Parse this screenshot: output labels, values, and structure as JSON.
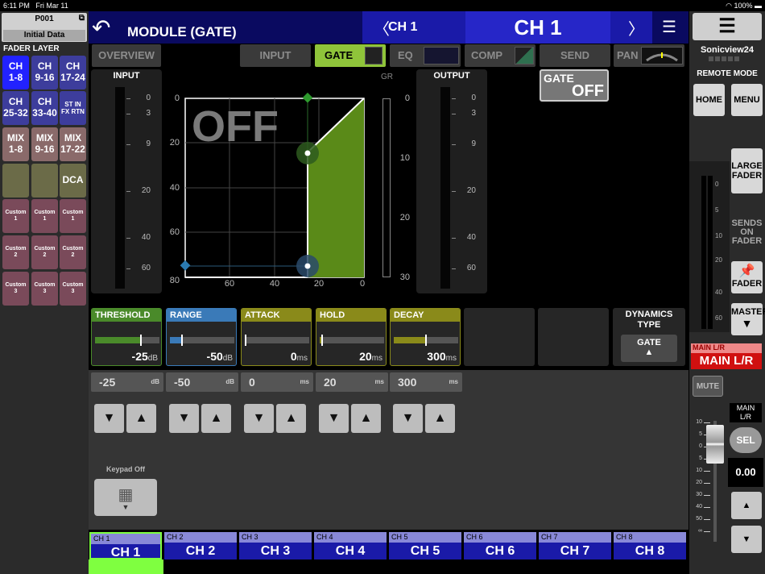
{
  "status": {
    "time": "6:11 PM",
    "date": "Fri Mar 11",
    "battery": "100%"
  },
  "scene": {
    "number": "P001",
    "title": "Initial Data"
  },
  "fader_layer": {
    "heading": "FADER LAYER",
    "buttons": [
      {
        "l1": "CH",
        "l2": "1-8"
      },
      {
        "l1": "CH",
        "l2": "9-16"
      },
      {
        "l1": "CH",
        "l2": "17-24"
      },
      {
        "l1": "CH",
        "l2": "25-32"
      },
      {
        "l1": "CH",
        "l2": "33-40"
      },
      {
        "l1": "ST IN",
        "l2": "FX RTN"
      },
      {
        "l1": "MIX",
        "l2": "1-8"
      },
      {
        "l1": "MIX",
        "l2": "9-16"
      },
      {
        "l1": "MIX",
        "l2": "17-22"
      },
      {
        "l1": "",
        "l2": ""
      },
      {
        "l1": "",
        "l2": ""
      },
      {
        "l1": "DCA",
        "l2": ""
      },
      {
        "l1": "Custom",
        "l2": "1"
      },
      {
        "l1": "Custom",
        "l2": "1"
      },
      {
        "l1": "Custom",
        "l2": "1"
      },
      {
        "l1": "Custom",
        "l2": "2"
      },
      {
        "l1": "Custom",
        "l2": "2"
      },
      {
        "l1": "Custom",
        "l2": "2"
      },
      {
        "l1": "Custom",
        "l2": "3"
      },
      {
        "l1": "Custom",
        "l2": "3"
      },
      {
        "l1": "Custom",
        "l2": "3"
      }
    ]
  },
  "header": {
    "title": "MODULE (GATE)",
    "ch_small": "CH 1",
    "ch_big": "CH 1"
  },
  "tabs": {
    "overview": "OVERVIEW",
    "input": "INPUT",
    "gate": "GATE",
    "eq": "EQ",
    "comp": "COMP",
    "send": "SEND",
    "pan": "PAN"
  },
  "input_meter": {
    "label": "INPUT",
    "scale": [
      "0",
      "3",
      "9",
      "20",
      "40",
      "60"
    ]
  },
  "output_meter": {
    "label": "OUTPUT",
    "scale": [
      "0",
      "3",
      "9",
      "20",
      "40",
      "60"
    ]
  },
  "graph": {
    "off_text": "OFF",
    "y_ticks": [
      "0",
      "20",
      "40",
      "60",
      "80"
    ],
    "x_ticks": [
      "60",
      "40",
      "20",
      "0"
    ],
    "gr_label": "GR",
    "gr_ticks": [
      "0",
      "10",
      "20",
      "30"
    ]
  },
  "gate_button": {
    "label": "GATE",
    "state": "OFF"
  },
  "params": [
    {
      "label": "THRESHOLD",
      "value": "-25",
      "unit": "dB",
      "color": "#4a8a2a",
      "level": 0.72
    },
    {
      "label": "RANGE",
      "value": "-50",
      "unit": "dB",
      "color": "#3a7ab8",
      "level": 0.18
    },
    {
      "label": "ATTACK",
      "value": "0",
      "unit": "ms",
      "color": "#8a8a1a",
      "level": 0.0
    },
    {
      "label": "HOLD",
      "value": "20",
      "unit": "ms",
      "color": "#8a8a1a",
      "level": 0.02
    },
    {
      "label": "DECAY",
      "value": "300",
      "unit": "ms",
      "color": "#8a8a1a",
      "level": 0.5
    }
  ],
  "dynamics": {
    "title1": "DYNAMICS",
    "title2": "TYPE",
    "value": "GATE"
  },
  "fields": [
    {
      "value": "-25",
      "unit": "dB"
    },
    {
      "value": "-50",
      "unit": "dB"
    },
    {
      "value": "0",
      "unit": "ms"
    },
    {
      "value": "20",
      "unit": "ms"
    },
    {
      "value": "300",
      "unit": "ms"
    }
  ],
  "keypad": {
    "label": "Keypad Off"
  },
  "channels": [
    {
      "top": "CH 1",
      "name": "CH 1"
    },
    {
      "top": "CH 2",
      "name": "CH 2"
    },
    {
      "top": "CH 3",
      "name": "CH 3"
    },
    {
      "top": "CH 4",
      "name": "CH 4"
    },
    {
      "top": "CH 5",
      "name": "CH 5"
    },
    {
      "top": "CH 6",
      "name": "CH 6"
    },
    {
      "top": "CH 7",
      "name": "CH 7"
    },
    {
      "top": "CH 8",
      "name": "CH 8"
    }
  ],
  "right": {
    "app": "Sonicview24",
    "remote": "REMOTE MODE",
    "home": "HOME",
    "menu": "MENU",
    "large_fader_1": "LARGE",
    "large_fader_2": "FADER",
    "sends1": "SENDS",
    "sends2": "ON",
    "sends3": "FADER",
    "fader": "FADER",
    "master": "MASTER",
    "meter_scale": [
      "0",
      "5",
      "10",
      "20",
      "40",
      "60"
    ],
    "main_small": "MAIN L/R",
    "main_big": "MAIN L/R",
    "mute": "MUTE",
    "main2a": "MAIN",
    "main2b": "L/R",
    "sel": "SEL",
    "fader_value": "0.00",
    "fader_scale": [
      "10",
      "5",
      "0",
      "5",
      "10",
      "20",
      "30",
      "40",
      "50",
      "∞"
    ]
  }
}
